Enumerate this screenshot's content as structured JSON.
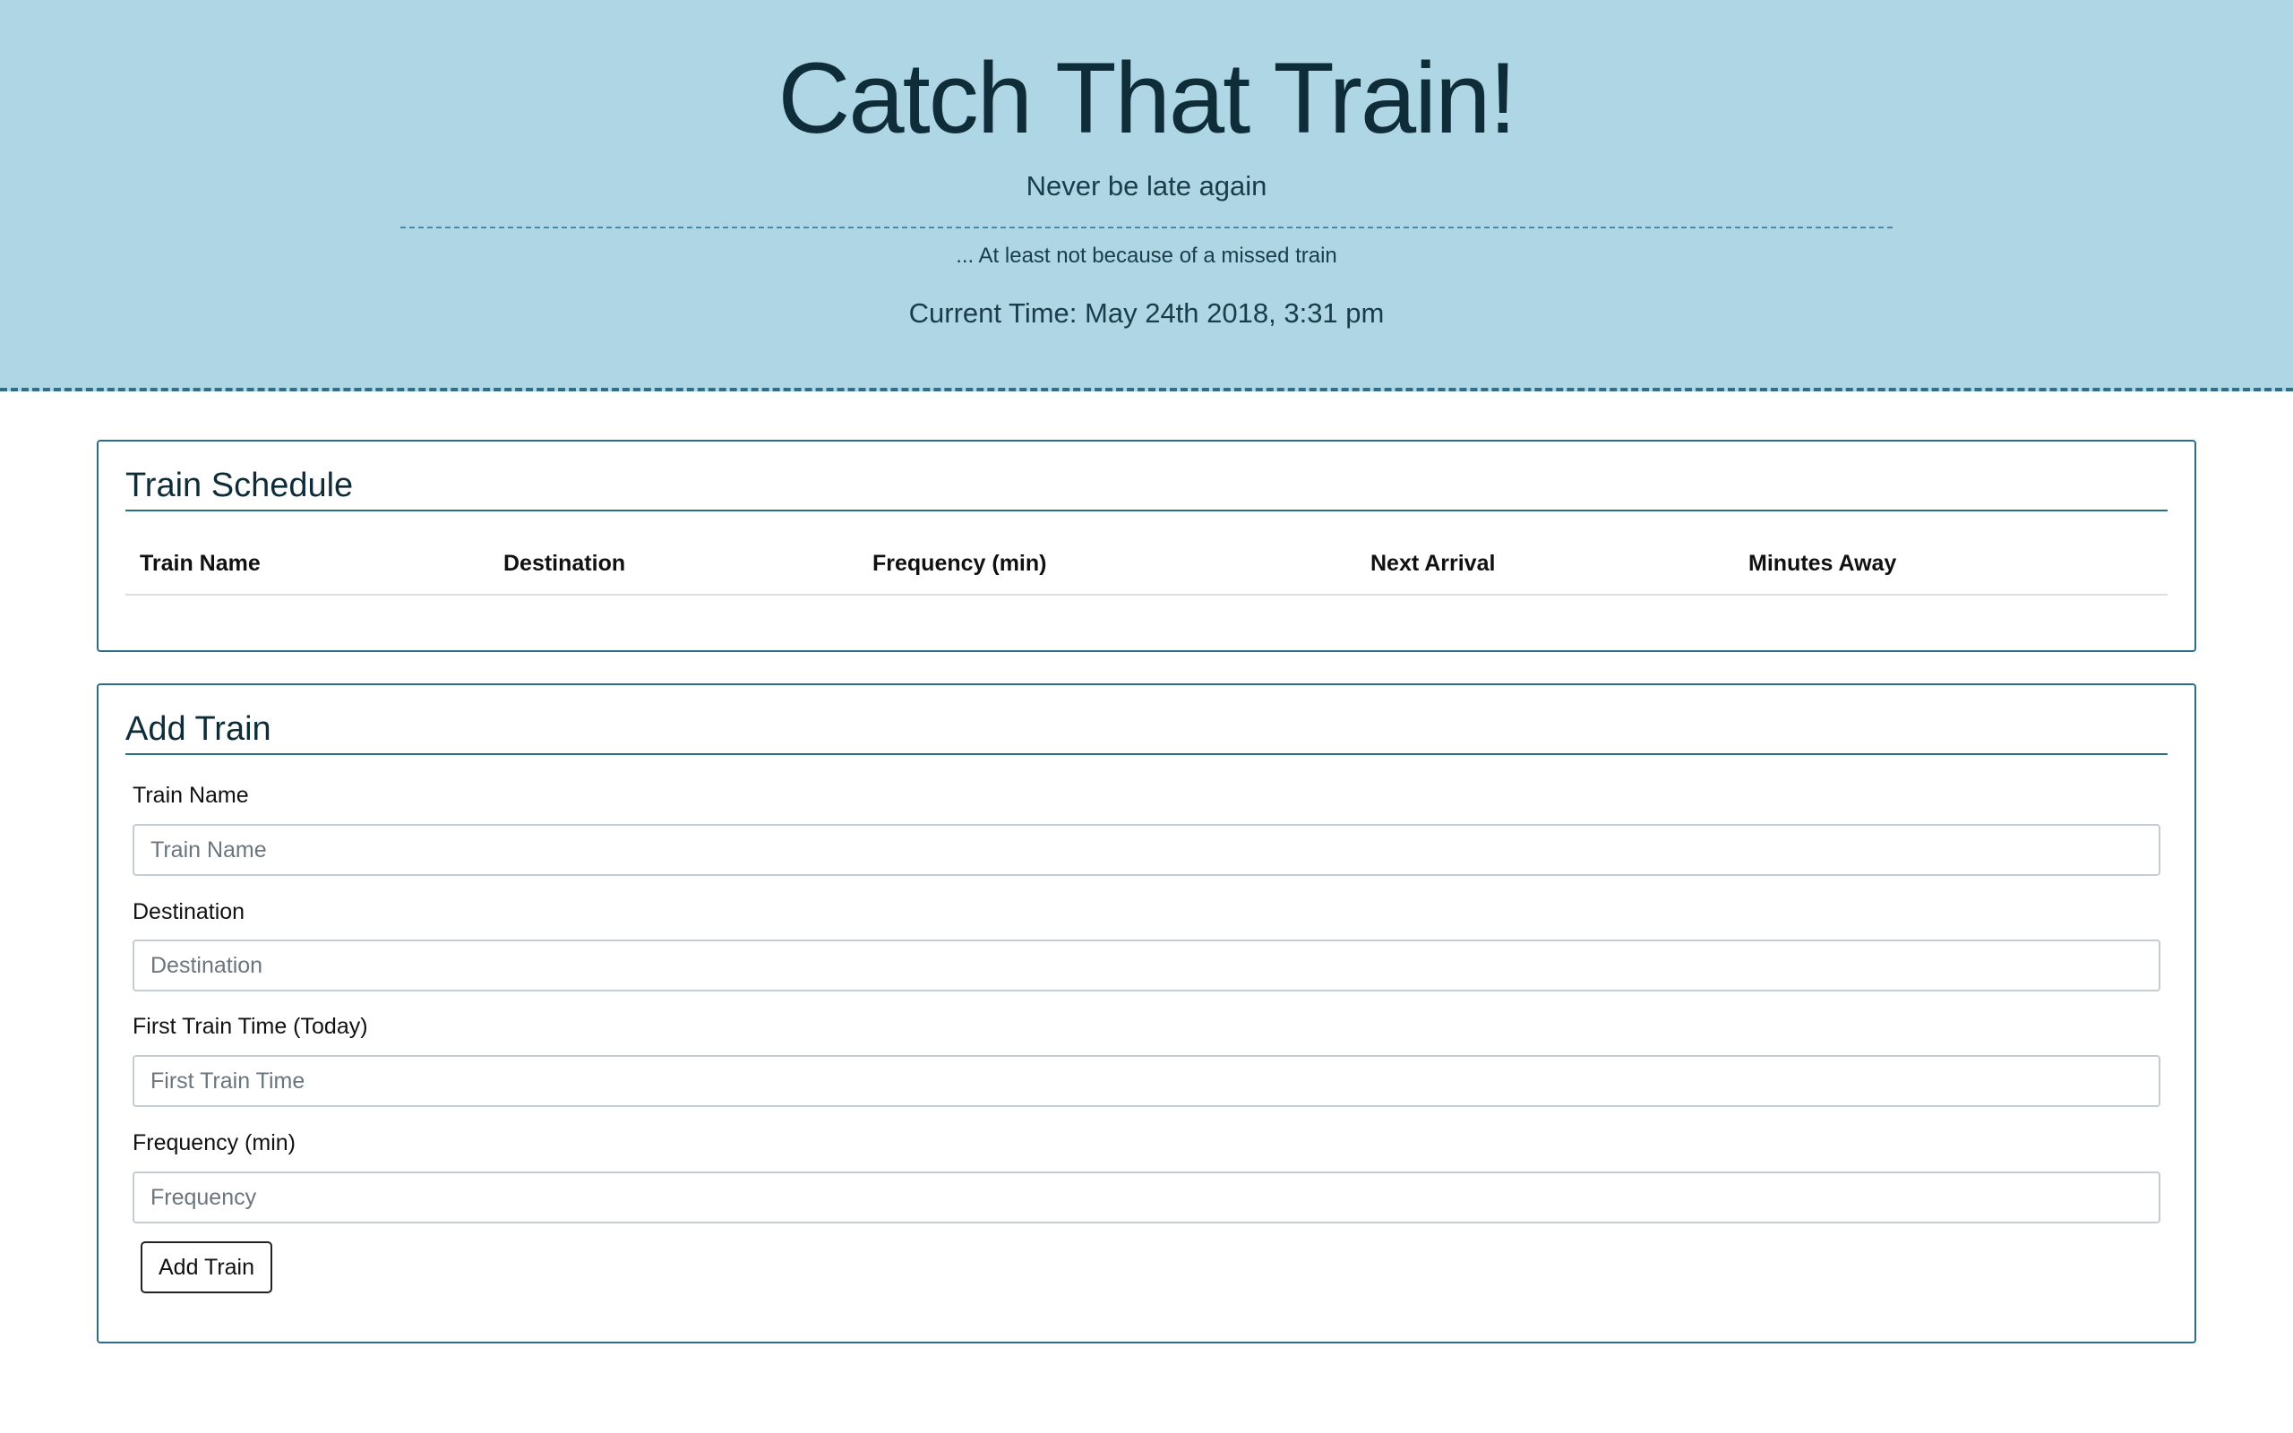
{
  "header": {
    "title": "Catch That Train!",
    "lead": "Never be late again",
    "sub": "... At least not because of a missed train",
    "current_time": "Current Time: May 24th 2018, 3:31 pm"
  },
  "schedule": {
    "heading": "Train Schedule",
    "columns": [
      "Train Name",
      "Destination",
      "Frequency (min)",
      "Next Arrival",
      "Minutes Away"
    ],
    "rows": []
  },
  "add_train": {
    "heading": "Add Train",
    "fields": [
      {
        "label": "Train Name",
        "placeholder": "Train Name",
        "value": ""
      },
      {
        "label": "Destination",
        "placeholder": "Destination",
        "value": ""
      },
      {
        "label": "First Train Time (Today)",
        "placeholder": "First Train Time",
        "value": ""
      },
      {
        "label": "Frequency (min)",
        "placeholder": "Frequency",
        "value": ""
      }
    ],
    "submit_label": "Add Train"
  },
  "colors": {
    "header_bg": "#afd6e4",
    "accent": "#2b6f86",
    "text_dark": "#0f2d38"
  }
}
